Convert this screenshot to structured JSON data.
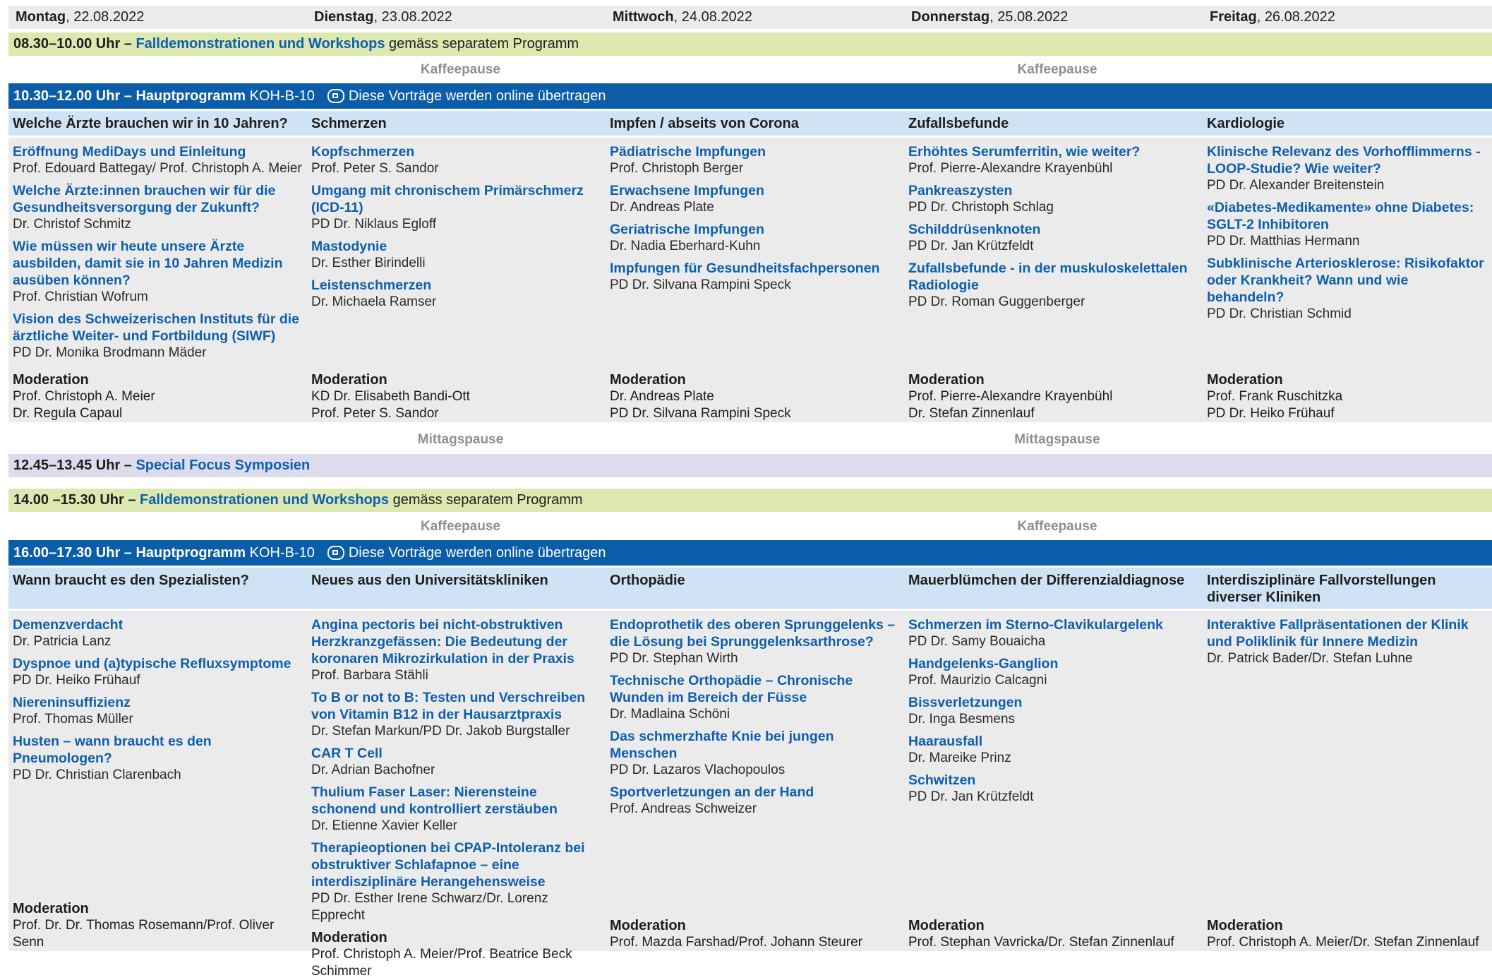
{
  "days": [
    {
      "name": "Montag",
      "date": "22.08.2022"
    },
    {
      "name": "Dienstag",
      "date": "23.08.2022"
    },
    {
      "name": "Mittwoch",
      "date": "24.08.2022"
    },
    {
      "name": "Donnerstag",
      "date": "25.08.2022"
    },
    {
      "name": "Freitag",
      "date": "26.08.2022"
    }
  ],
  "workshop_am": {
    "time": "08.30–10.00 Uhr –",
    "title": "Falldemonstrationen und Workshops",
    "note": "gemäss separatem Programm"
  },
  "workshop_pm": {
    "time": "14.00 –15.30 Uhr –",
    "title": "Falldemonstrationen und Workshops",
    "note": "gemäss separatem Programm"
  },
  "coffee": "Kaffeepause",
  "lunch": "Mittagspause",
  "symposium": {
    "time": "12.45–13.45 Uhr –",
    "title": "Special Focus Symposien"
  },
  "main_am": {
    "time": "10.30–12.00 Uhr –",
    "title": "Hauptprogramm",
    "room": "KOH-B-10",
    "online": "Diese Vorträge werden online übertragen"
  },
  "main_pm": {
    "time": "16.00–17.30 Uhr –",
    "title": "Hauptprogramm",
    "room": "KOH-B-10",
    "online": "Diese Vorträge werden online übertragen"
  },
  "moderation_label": "Moderation",
  "am": [
    {
      "topic": "Welche Ärzte brauchen wir in 10 Jahren?",
      "talks": [
        {
          "title": "Eröffnung MediDays und Einleitung",
          "speaker": "Prof. Edouard Battegay/ Prof. Christoph A. Meier"
        },
        {
          "title": "Welche Ärzte:innen brauchen wir für die Gesundheitsversorgung der Zukunft?",
          "speaker": "Dr. Christof Schmitz"
        },
        {
          "title": "Wie müssen wir heute unsere Ärzte ausbilden, damit sie in 10 Jahren Medizin ausüben können?",
          "speaker": "Prof. Christian Wofrum"
        },
        {
          "title": "Vision des Schweizerischen Instituts für die ärztliche Weiter- und Fortbildung (SIWF)",
          "speaker": "PD Dr. Monika Brodmann Mäder"
        }
      ],
      "moderators": [
        "Prof. Christoph A. Meier",
        "Dr. Regula Capaul"
      ]
    },
    {
      "topic": "Schmerzen",
      "talks": [
        {
          "title": "Kopfschmerzen",
          "speaker": "Prof. Peter S. Sandor"
        },
        {
          "title": "Umgang mit chronischem Primärschmerz (ICD-11)",
          "speaker": "PD Dr. Niklaus Egloff"
        },
        {
          "title": "Mastodynie",
          "speaker": "Dr. Esther Birindelli"
        },
        {
          "title": "Leistenschmerzen",
          "speaker": "Dr. Michaela Ramser"
        }
      ],
      "moderators": [
        "KD Dr. Elisabeth Bandi-Ott",
        "Prof. Peter S. Sandor"
      ]
    },
    {
      "topic": "Impfen / abseits von Corona",
      "talks": [
        {
          "title": "Pädiatrische Impfungen",
          "speaker": "Prof. Christoph Berger"
        },
        {
          "title": "Erwachsene Impfungen",
          "speaker": "Dr. Andreas Plate"
        },
        {
          "title": "Geriatrische Impfungen",
          "speaker": "Dr. Nadia Eberhard-Kuhn"
        },
        {
          "title": "Impfungen für Gesundheitsfachpersonen",
          "speaker": "PD Dr. Silvana Rampini Speck"
        }
      ],
      "moderators": [
        "Dr. Andreas Plate",
        "PD Dr. Silvana Rampini Speck"
      ]
    },
    {
      "topic": "Zufallsbefunde",
      "talks": [
        {
          "title": "Erhöhtes Serumferritin, wie weiter?",
          "speaker": "Prof. Pierre-Alexandre Krayenbühl"
        },
        {
          "title": "Pankreaszysten",
          "speaker": "PD Dr. Christoph Schlag"
        },
        {
          "title": "Schilddrüsenknoten",
          "speaker": "PD Dr. Jan Krützfeldt"
        },
        {
          "title": "Zufallsbefunde - in der muskuloskelettalen Radiologie",
          "speaker": "PD Dr. Roman Guggenberger"
        }
      ],
      "moderators": [
        "Prof. Pierre-Alexandre Krayenbühl",
        "Dr. Stefan Zinnenlauf"
      ]
    },
    {
      "topic": "Kardiologie",
      "talks": [
        {
          "title": "Klinische Relevanz des Vorhofflimmerns - LOOP-Studie? Wie weiter?",
          "speaker": "PD Dr. Alexander Breitenstein"
        },
        {
          "title": "«Diabetes-Medikamente» ohne Diabetes: SGLT-2 Inhibitoren",
          "speaker": "PD Dr. Matthias Hermann"
        },
        {
          "title": "Subklinische Arteriosklerose: Risikofaktor oder Krankheit? Wann und wie behandeln?",
          "speaker": "PD Dr. Christian Schmid"
        }
      ],
      "moderators": [
        "Prof. Frank Ruschitzka",
        "PD Dr. Heiko Frühauf"
      ]
    }
  ],
  "pm": [
    {
      "topic": "Wann braucht es den Spezialisten?",
      "talks": [
        {
          "title": "Demenzverdacht",
          "speaker": "Dr. Patricia Lanz"
        },
        {
          "title": "Dyspnoe und (a)typische Refluxsymptome",
          "speaker": "PD Dr. Heiko Frühauf"
        },
        {
          "title": "Niereninsuffizienz",
          "speaker": "Prof. Thomas Müller"
        },
        {
          "title": "Husten – wann braucht es den Pneumologen?",
          "speaker": "PD Dr. Christian Clarenbach"
        }
      ],
      "moderators": [
        "Prof. Dr. Dr. Thomas Rosemann/Prof. Oliver Senn"
      ]
    },
    {
      "topic": "Neues aus den Universitätskliniken",
      "talks": [
        {
          "title": "Angina pectoris bei nicht-obstruktiven Herzkranzgefässen: Die Bedeutung der koronaren Mikrozirkulation in der Praxis",
          "speaker": "Prof. Barbara Stähli"
        },
        {
          "title": "To B or not to B: Testen und Verschreiben von Vitamin B12 in der Hausarztpraxis",
          "speaker": "Dr. Stefan Markun/PD Dr. Jakob Burgstaller"
        },
        {
          "title": "CAR T Cell",
          "speaker": "Dr. Adrian Bachofner"
        },
        {
          "title": "Thulium Faser Laser: Nierensteine schonend und kontrolliert zerstäuben",
          "speaker": "Dr. Etienne Xavier Keller"
        },
        {
          "title": "Therapieoptionen bei CPAP-Intoleranz bei obstruktiver Schlafapnoe – eine interdisziplinäre Herangehensweise",
          "speaker": "PD Dr. Esther Irene Schwarz/Dr. Lorenz Epprecht"
        }
      ],
      "moderators": [
        "Prof. Christoph A. Meier/Prof. Beatrice Beck Schimmer"
      ]
    },
    {
      "topic": "Orthopädie",
      "talks": [
        {
          "title": "Endoprothetik des oberen Sprunggelenks – die Lösung bei Sprunggelenksarthrose?",
          "speaker": "PD Dr. Stephan Wirth"
        },
        {
          "title": "Technische Orthopädie – Chronische Wunden im Bereich der Füsse",
          "speaker": "Dr. Madlaina Schöni"
        },
        {
          "title": "Das schmerzhafte Knie bei jungen Menschen",
          "speaker": "PD Dr. Lazaros Vlachopoulos"
        },
        {
          "title": "Sportverletzungen an der Hand",
          "speaker": "Prof. Andreas Schweizer"
        }
      ],
      "moderators": [
        "Prof. Mazda Farshad/Prof. Johann Steurer"
      ]
    },
    {
      "topic": "Mauerblümchen der Differenzialdiagnose",
      "talks": [
        {
          "title": "Schmerzen im Sterno-Clavikulargelenk",
          "speaker": "PD Dr. Samy Bouaicha"
        },
        {
          "title": "Handgelenks-Ganglion",
          "speaker": "Prof. Maurizio Calcagni"
        },
        {
          "title": "Bissverletzungen",
          "speaker": "Dr. Inga Besmens"
        },
        {
          "title": "Haarausfall",
          "speaker": "Dr. Mareike Prinz"
        },
        {
          "title": "Schwitzen",
          "speaker": "PD Dr. Jan Krützfeldt"
        }
      ],
      "moderators": [
        "Prof. Stephan Vavricka/Dr. Stefan Zinnenlauf"
      ]
    },
    {
      "topic": "Interdisziplinäre Fallvorstellungen diverser Kliniken",
      "talks": [
        {
          "title": "Interaktive Fallpräsentationen der Klinik und Poliklinik für Innere Medizin",
          "speaker": "Dr. Patrick Bader/Dr. Stefan Luhne"
        }
      ],
      "moderators": [
        "Prof. Christoph A. Meier/Dr. Stefan Zinnenlauf"
      ]
    }
  ]
}
